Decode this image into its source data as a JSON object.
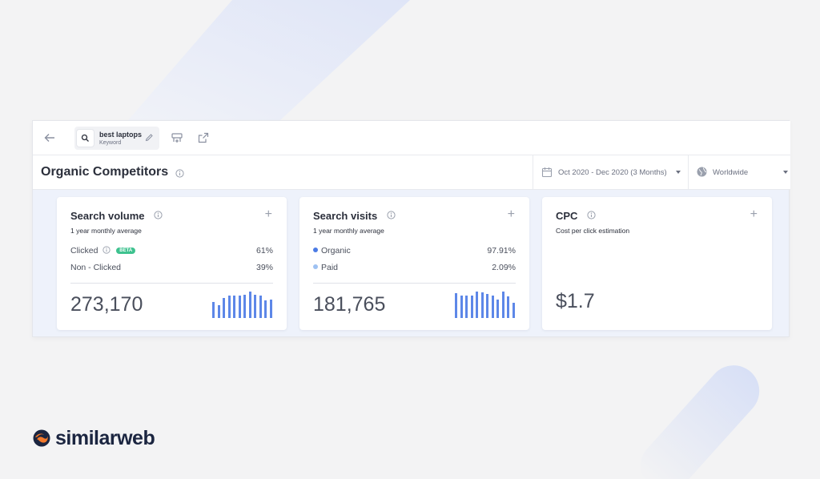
{
  "colors": {
    "accent": "#5d87e8",
    "organic_dot": "#4b7be5",
    "paid_dot": "#9ec1f2",
    "beta_badge": "#3ec28f",
    "logo_orange": "#f3792b",
    "logo_navy": "#1b2540"
  },
  "toolbar": {
    "back_icon": "arrow-left-icon",
    "keyword": "best laptops",
    "keyword_type": "Keyword",
    "edit_icon": "pencil-icon",
    "compare_icon": "compare-icon",
    "external_icon": "external-link-icon"
  },
  "header": {
    "title": "Organic Competitors",
    "date_range": "Oct 2020 - Dec 2020 (3 Months)",
    "country": "Worldwide"
  },
  "cards": [
    {
      "title": "Search volume",
      "subtitle": "1 year monthly average",
      "rows": [
        {
          "label": "Clicked",
          "badge": "BETA",
          "value": "61%"
        },
        {
          "label": "Non - Clicked",
          "value": "39%"
        }
      ],
      "total": "273,170",
      "trend": [
        0.55,
        0.45,
        0.7,
        0.78,
        0.78,
        0.78,
        0.8,
        0.92,
        0.8,
        0.78,
        0.62,
        0.65
      ]
    },
    {
      "title": "Search visits",
      "subtitle": "1 year monthly average",
      "rows": [
        {
          "label": "Organic",
          "value": "97.91%"
        },
        {
          "label": "Paid",
          "value": "2.09%"
        }
      ],
      "total": "181,765",
      "trend": [
        0.85,
        0.78,
        0.78,
        0.78,
        0.92,
        0.9,
        0.82,
        0.78,
        0.65,
        0.92,
        0.75,
        0.52
      ]
    },
    {
      "title": "CPC",
      "subtitle": "Cost per click estimation",
      "total": "$1.7"
    }
  ],
  "brand": {
    "name": "similarweb"
  }
}
